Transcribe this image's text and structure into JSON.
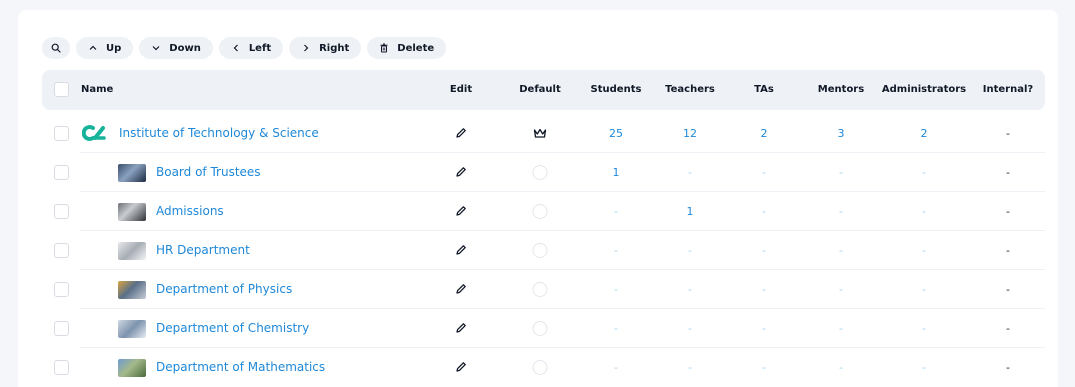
{
  "toolbar": {
    "up_label": "Up",
    "down_label": "Down",
    "left_label": "Left",
    "right_label": "Right",
    "delete_label": "Delete"
  },
  "columns": {
    "name": "Name",
    "edit": "Edit",
    "default": "Default",
    "students": "Students",
    "teachers": "Teachers",
    "tas": "TAs",
    "mentors": "Mentors",
    "administrators": "Administrators",
    "internal": "Internal?"
  },
  "rows": [
    {
      "name": "Institute of Technology & Science",
      "students": "25",
      "teachers": "12",
      "tas": "2",
      "mentors": "3",
      "administrators": "2",
      "internal": "-"
    },
    {
      "name": "Board of Trustees",
      "students": "1",
      "teachers": "-",
      "tas": "-",
      "mentors": "-",
      "administrators": "-",
      "internal": "-"
    },
    {
      "name": "Admissions",
      "students": "-",
      "teachers": "1",
      "tas": "-",
      "mentors": "-",
      "administrators": "-",
      "internal": "-"
    },
    {
      "name": "HR Department",
      "students": "-",
      "teachers": "-",
      "tas": "-",
      "mentors": "-",
      "administrators": "-",
      "internal": "-"
    },
    {
      "name": "Department of Physics",
      "students": "-",
      "teachers": "-",
      "tas": "-",
      "mentors": "-",
      "administrators": "-",
      "internal": "-"
    },
    {
      "name": "Department of Chemistry",
      "students": "-",
      "teachers": "-",
      "tas": "-",
      "mentors": "-",
      "administrators": "-",
      "internal": "-"
    },
    {
      "name": "Department of Mathematics",
      "students": "-",
      "teachers": "-",
      "tas": "-",
      "mentors": "-",
      "administrators": "-",
      "internal": "-"
    }
  ],
  "colors": {
    "link": "#1e88d8",
    "dash_link": "#9fd0f0",
    "logo": "#16b39a",
    "header_bg": "#eef1f6"
  },
  "icons": {
    "search": "search-icon",
    "up": "chevron-up-icon",
    "down": "chevron-down-icon",
    "left": "chevron-left-icon",
    "right": "chevron-right-icon",
    "delete": "trash-icon",
    "edit": "pencil-icon",
    "default": "crown-icon",
    "logo": "institute-logo-icon"
  }
}
